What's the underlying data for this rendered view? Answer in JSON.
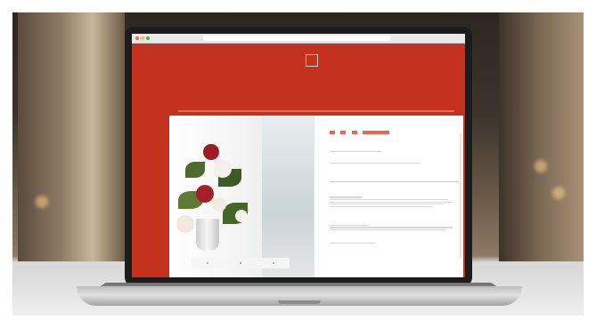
{
  "scene": {
    "site": {
      "nav": [
        "",
        "",
        "",
        "",
        "",
        "",
        ""
      ],
      "address": "",
      "title": ""
    },
    "colors": {
      "site_red": "#c5311f",
      "laptop_dark": "#1c1c1c",
      "laptop_silver": "#c8c8c8"
    }
  }
}
